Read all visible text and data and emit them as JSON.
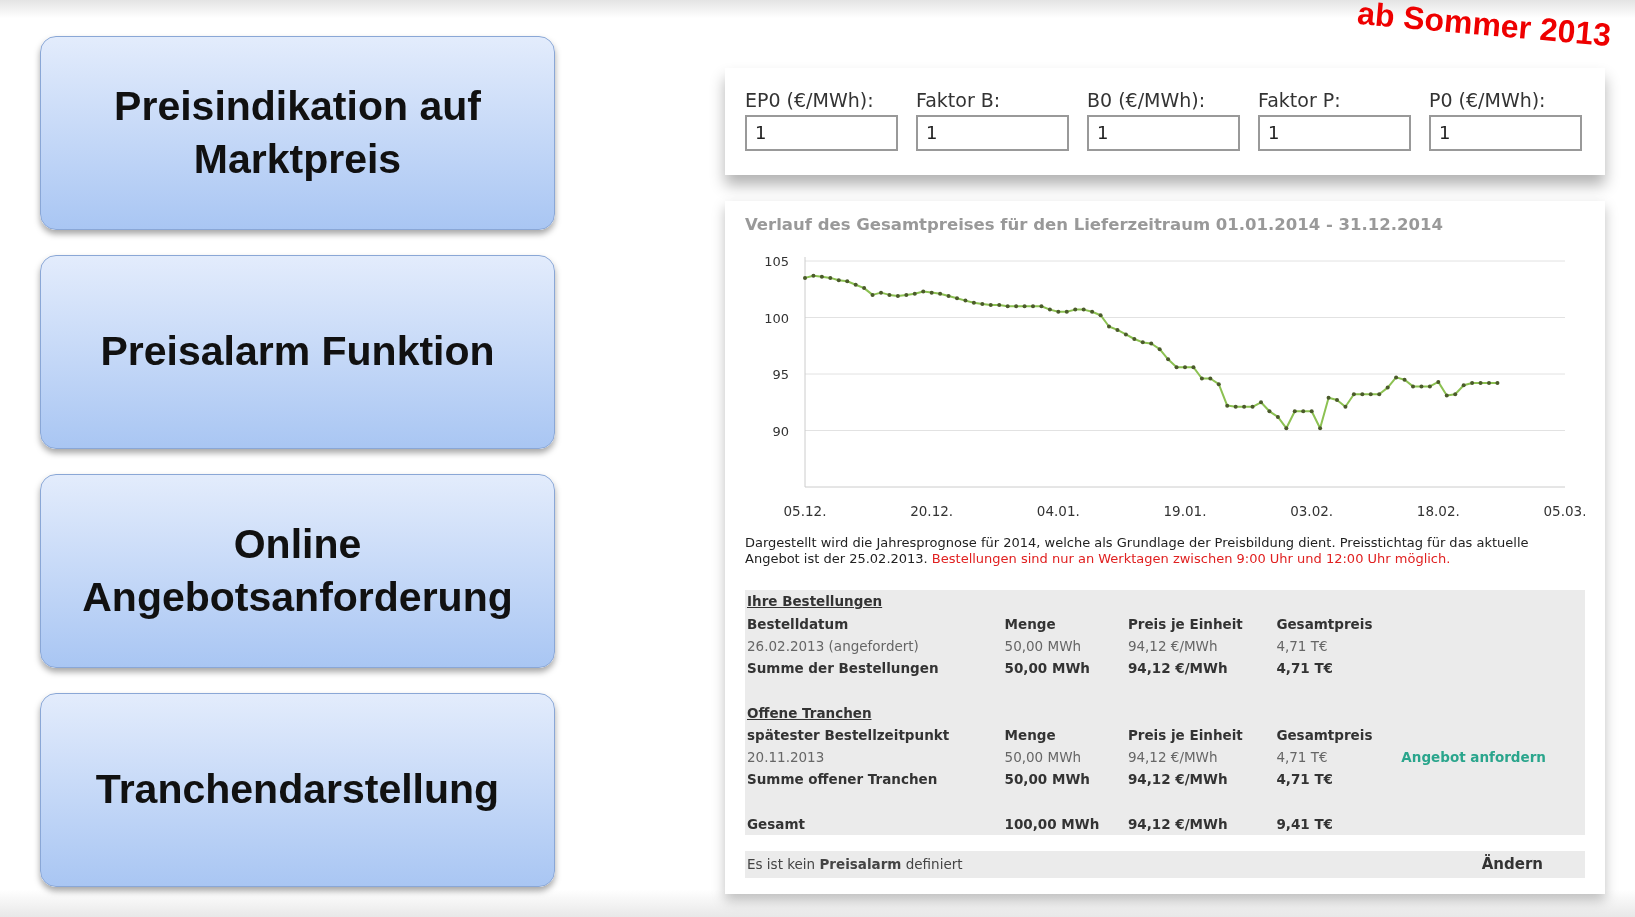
{
  "menu_buttons": [
    "Preisindikation auf Marktpreis",
    "Preisalarm Funktion",
    "Online Angebotsanforderung",
    "Tranchendarstellung"
  ],
  "stamp": "ab Sommer 2013",
  "parameters": [
    {
      "label": "EP0 (€/MWh):",
      "value": "1"
    },
    {
      "label": "Faktor B:",
      "value": "1"
    },
    {
      "label": "B0 (€/MWh):",
      "value": "1"
    },
    {
      "label": "Faktor P:",
      "value": "1"
    },
    {
      "label": "P0 (€/MWh):",
      "value": "1"
    }
  ],
  "chart": {
    "title": "Verlauf des Gesamtpreises für den Lieferzeitraum 01.01.2014 - 31.12.2014",
    "chart_data": {
      "type": "line",
      "categories": [
        "05.12.",
        null,
        null,
        null,
        null,
        null,
        null,
        null,
        null,
        null,
        null,
        null,
        null,
        null,
        null,
        "20.12.",
        null,
        null,
        null,
        null,
        null,
        null,
        null,
        null,
        null,
        null,
        null,
        null,
        null,
        null,
        "04.01.",
        null,
        null,
        null,
        null,
        null,
        null,
        null,
        null,
        null,
        null,
        null,
        null,
        null,
        null,
        "19.01.",
        null,
        null,
        null,
        null,
        null,
        null,
        null,
        null,
        null,
        null,
        null,
        null,
        null,
        null,
        "03.02.",
        null,
        null,
        null,
        null,
        null,
        null,
        null,
        null,
        null,
        null,
        null,
        null,
        null,
        null,
        "18.02.",
        null,
        null,
        null,
        null,
        null,
        null,
        null,
        null,
        null,
        null,
        null,
        null,
        null,
        null,
        "05.03."
      ],
      "series": [
        {
          "color": "#8cc152",
          "values": [
            103.5,
            103.7,
            103.6,
            103.5,
            103.3,
            103.2,
            102.9,
            102.6,
            102.0,
            102.2,
            102.0,
            101.9,
            102.0,
            102.1,
            102.3,
            102.2,
            102.1,
            101.9,
            101.7,
            101.5,
            101.3,
            101.2,
            101.1,
            101.1,
            101.0,
            101.0,
            101.0,
            101.0,
            101.0,
            100.7,
            100.5,
            100.5,
            100.7,
            100.7,
            100.5,
            100.2,
            99.2,
            98.9,
            98.5,
            98.1,
            97.8,
            97.7,
            97.2,
            96.3,
            95.6,
            95.6,
            95.6,
            94.6,
            94.6,
            94.1,
            92.2,
            92.1,
            92.1,
            92.1,
            92.5,
            91.7,
            91.2,
            90.2,
            91.7,
            91.7,
            91.7,
            90.2,
            92.9,
            92.7,
            92.1,
            93.2,
            93.2,
            93.2,
            93.2,
            93.8,
            94.7,
            94.5,
            93.9,
            93.9,
            93.9,
            94.3,
            93.1,
            93.2,
            94.0,
            94.2,
            94.2,
            94.2,
            94.2,
            null,
            null,
            null,
            null,
            null,
            null,
            null,
            null
          ]
        }
      ],
      "ylim": [
        85,
        105
      ],
      "grid": true,
      "yticks": [
        90,
        95,
        100,
        105
      ]
    }
  },
  "note": "Dargestellt wird die Jahresprognose für 2014, welche als Grundlage der Preisbildung dient. Preisstichtag für das aktuelle Angebot ist der 25.02.2013.",
  "warning": "Bestellungen sind nur an Werktagen zwischen 9:00 Uhr und 12:00 Uhr möglich.",
  "sections": [
    {
      "title": "Ihre Bestellungen",
      "columns": [
        "Bestelldatum",
        "Menge",
        "Preis je Einheit",
        "Gesamtpreis"
      ],
      "rows": [
        {
          "kind": "item",
          "cells": [
            "26.02.2013 (angefordert)",
            "50,00 MWh",
            "94,12 €/MWh",
            "4,71 T€"
          ]
        },
        {
          "kind": "sum",
          "cells": [
            "Summe der Bestellungen",
            "50,00 MWh",
            "94,12 €/MWh",
            "4,71 T€"
          ]
        }
      ]
    },
    {
      "title": "Offene Tranchen",
      "columns": [
        "spätester Bestellzeitpunkt",
        "Menge",
        "Preis je Einheit",
        "Gesamtpreis"
      ],
      "rows": [
        {
          "kind": "item",
          "cells": [
            "20.11.2013",
            "50,00 MWh",
            "94,12 €/MWh",
            "4,71 T€"
          ],
          "action": "Angebot anfordern"
        },
        {
          "kind": "sum",
          "cells": [
            "Summe offener Tranchen",
            "50,00 MWh",
            "94,12 €/MWh",
            "4,71 T€"
          ]
        }
      ]
    }
  ],
  "total": {
    "cells": [
      "Gesamt",
      "100,00 MWh",
      "94,12 €/MWh",
      "9,41 T€"
    ]
  },
  "alarm": {
    "text": "Es ist kein **Preisalarm** definiert",
    "action": "Ändern"
  }
}
